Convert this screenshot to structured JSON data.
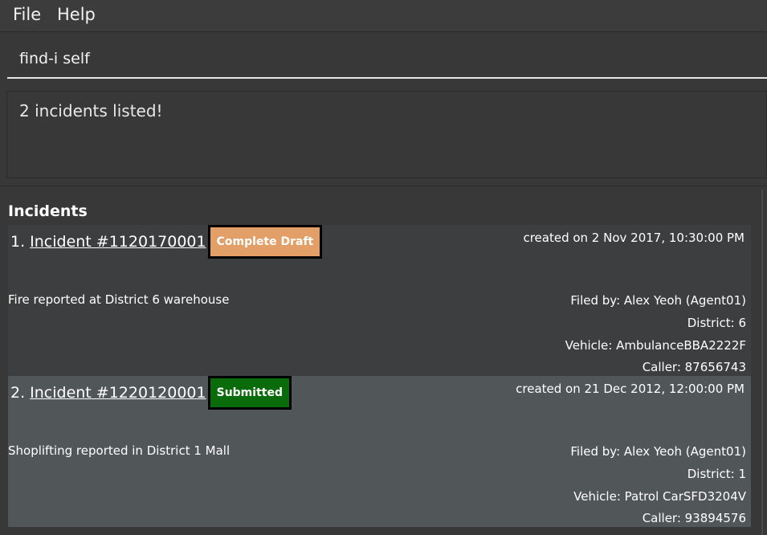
{
  "menubar": {
    "items": [
      {
        "label": "File"
      },
      {
        "label": "Help"
      }
    ]
  },
  "command": {
    "value": "find-i self"
  },
  "result": {
    "message": "2 incidents listed!"
  },
  "list": {
    "title": "Incidents",
    "incidents": [
      {
        "index": "1.",
        "id": "Incident #1120170001",
        "status": "Complete Draft",
        "status_color": "#e39f68",
        "created": "created on 2 Nov 2017, 10:30:00 PM",
        "description": "Fire reported at District 6 warehouse",
        "filed_by": "Filed by: Alex Yeoh (Agent01)",
        "district": "District: 6",
        "vehicle": "Vehicle: AmbulanceBBA2222F",
        "caller": "Caller: 87656743"
      },
      {
        "index": "2.",
        "id": "Incident #1220120001",
        "status": "Submitted",
        "status_color": "#0a6b0a",
        "created": "created on 21 Dec 2012, 12:00:00 PM",
        "description": "Shoplifting reported in District 1 Mall",
        "filed_by": "Filed by: Alex Yeoh (Agent01)",
        "district": "District: 1",
        "vehicle": "Vehicle: Patrol CarSFD3204V",
        "caller": "Caller: 93894576"
      }
    ]
  }
}
